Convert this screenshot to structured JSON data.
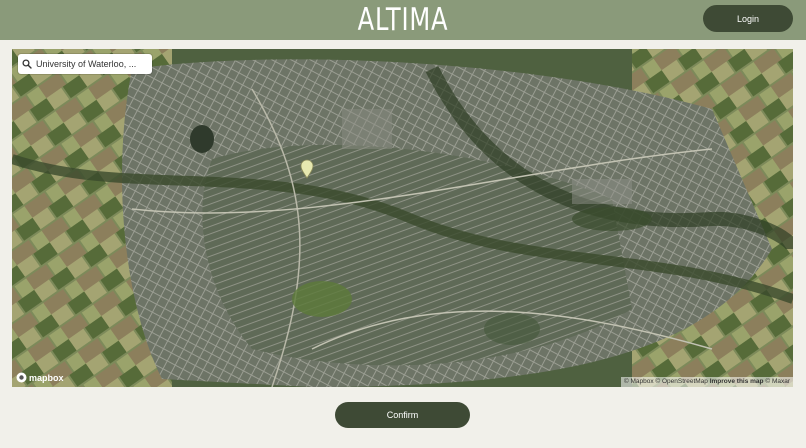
{
  "header": {
    "logo": "ALTIMA",
    "login_label": "Login"
  },
  "map": {
    "search": {
      "value": "University of Waterloo, ...",
      "icon": "search-icon"
    },
    "marker_icon": "map-pin-icon",
    "provider_logo": "mapbox",
    "attribution": {
      "mapbox": "© Mapbox",
      "osm": "© OpenStreetMap",
      "improve": "Improve this map",
      "maxar": "© Maxar"
    }
  },
  "footer": {
    "confirm_label": "Confirm"
  },
  "colors": {
    "header_bg": "#8a9a7a",
    "button_bg": "#3e4a35",
    "page_bg": "#f1f0ea",
    "pin_color": "#e6e8b0"
  }
}
